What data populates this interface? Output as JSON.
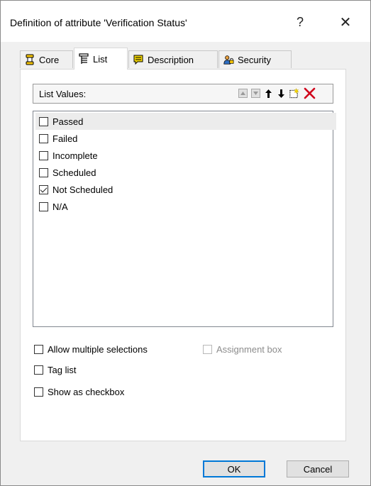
{
  "window": {
    "title": "Definition of attribute 'Verification Status'",
    "help_glyph": "?",
    "close_glyph": "✕"
  },
  "tabs": [
    {
      "label": "Core",
      "icon": "core-icon"
    },
    {
      "label": "List",
      "icon": "list-icon",
      "active": true
    },
    {
      "label": "Description",
      "icon": "description-icon"
    },
    {
      "label": "Security",
      "icon": "security-icon"
    }
  ],
  "list_panel": {
    "header_label": "List Values:",
    "header_buttons": [
      "move-top-icon",
      "move-bottom-icon",
      "move-up-icon",
      "move-down-icon",
      "new-item-icon",
      "delete-icon"
    ],
    "items": [
      {
        "label": "Passed",
        "checked": false,
        "selected": true
      },
      {
        "label": "Failed",
        "checked": false
      },
      {
        "label": "Incomplete",
        "checked": false
      },
      {
        "label": "Scheduled",
        "checked": false
      },
      {
        "label": "Not Scheduled",
        "checked": true
      },
      {
        "label": "N/A",
        "checked": false
      }
    ]
  },
  "options": {
    "allow_multiple": {
      "label": "Allow multiple selections",
      "checked": false
    },
    "assignment_box": {
      "label": "Assignment box",
      "checked": false,
      "disabled": true
    },
    "tag_list": {
      "label": "Tag list",
      "checked": false
    },
    "show_as_checkbox": {
      "label": "Show as checkbox",
      "checked": false
    }
  },
  "buttons": {
    "ok": "OK",
    "cancel": "Cancel"
  },
  "colors": {
    "accent": "#0078d7",
    "delete_red": "#d0021b",
    "note_yellow": "#f5d800"
  }
}
